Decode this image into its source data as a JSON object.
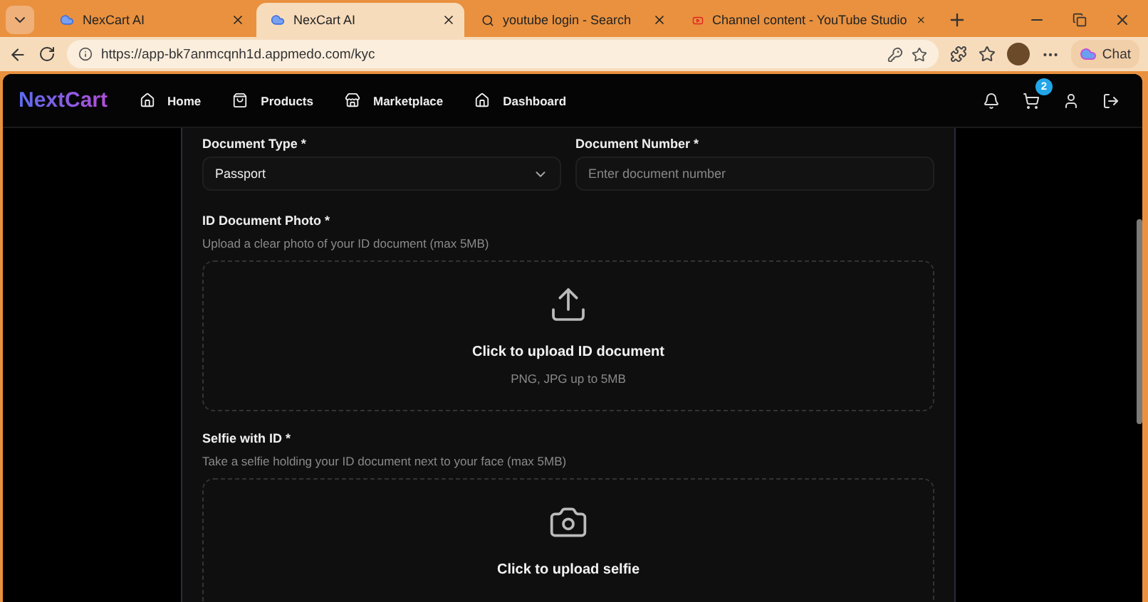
{
  "browser": {
    "tabs": [
      {
        "title": "NexCart AI",
        "selected": false
      },
      {
        "title": "NexCart AI",
        "selected": true
      },
      {
        "title": "youtube login - Search",
        "selected": false
      },
      {
        "title": "Channel content - YouTube Studio",
        "selected": false
      }
    ],
    "url": "https://app-bk7anmcqnh1d.appmedo.com/kyc",
    "chat_label": "Chat"
  },
  "header": {
    "logo": "NextCart",
    "nav": [
      {
        "label": "Home"
      },
      {
        "label": "Products"
      },
      {
        "label": "Marketplace"
      },
      {
        "label": "Dashboard"
      }
    ],
    "cart_count": "2"
  },
  "form": {
    "document_type": {
      "label": "Document Type *",
      "value": "Passport"
    },
    "document_number": {
      "label": "Document Number *",
      "placeholder": "Enter document number"
    },
    "uploads": [
      {
        "label": "ID Document Photo *",
        "hint": "Upload a clear photo of your ID document (max 5MB)",
        "action": "Click to upload ID document",
        "note": "PNG, JPG up to 5MB"
      },
      {
        "label": "Selfie with ID *",
        "hint": "Take a selfie holding your ID document next to your face (max 5MB)",
        "action": "Click to upload selfie"
      }
    ]
  }
}
